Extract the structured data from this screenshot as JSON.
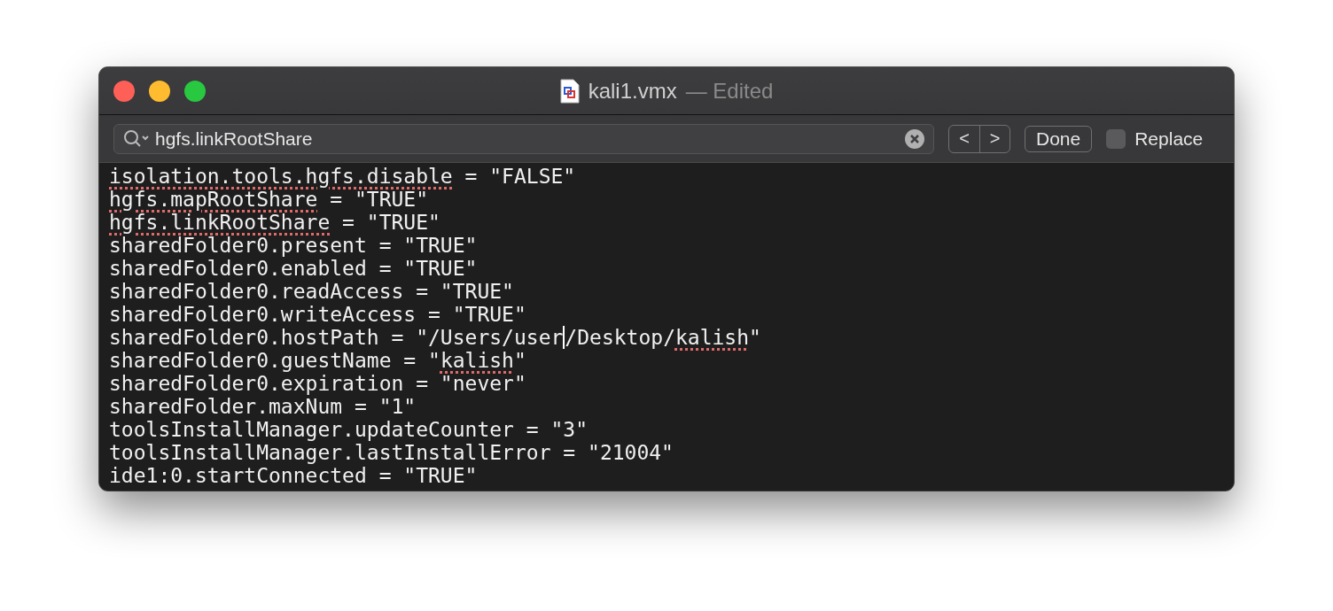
{
  "window": {
    "title": "kali1.vmx",
    "subtitle": "— Edited"
  },
  "find_bar": {
    "query": "hgfs.linkRootShare",
    "previous": "<",
    "next": ">",
    "done": "Done",
    "replace": {
      "label": "Replace",
      "checked": false
    }
  },
  "editor": {
    "lines": [
      [
        {
          "text": "isolation.tools.hgfs.disable",
          "misspelled": true
        },
        {
          "text": " = \"FALSE\"",
          "misspelled": false
        }
      ],
      [
        {
          "text": "hgfs.mapRootShare",
          "misspelled": true
        },
        {
          "text": " = \"TRUE\"",
          "misspelled": false
        }
      ],
      [
        {
          "text": "hgfs.linkRootShare",
          "misspelled": true
        },
        {
          "text": " = \"TRUE\"",
          "misspelled": false
        }
      ],
      [
        {
          "text": "sharedFolder0.present = \"TRUE\"",
          "misspelled": false
        }
      ],
      [
        {
          "text": "sharedFolder0.enabled = \"TRUE\"",
          "misspelled": false
        }
      ],
      [
        {
          "text": "sharedFolder0.readAccess = \"TRUE\"",
          "misspelled": false
        }
      ],
      [
        {
          "text": "sharedFolder0.writeAccess = \"TRUE\"",
          "misspelled": false
        }
      ],
      [
        {
          "text": "sharedFolder0.hostPath = \"/Users/user",
          "misspelled": false,
          "caret": true
        },
        {
          "text": "/Desktop/",
          "misspelled": false
        },
        {
          "text": "kalish",
          "misspelled": true
        },
        {
          "text": "\"",
          "misspelled": false
        }
      ],
      [
        {
          "text": "sharedFolder0.guestName = \"",
          "misspelled": false
        },
        {
          "text": "kalish",
          "misspelled": true
        },
        {
          "text": "\"",
          "misspelled": false
        }
      ],
      [
        {
          "text": "sharedFolder0.expiration = \"never\"",
          "misspelled": false
        }
      ],
      [
        {
          "text": "sharedFolder.maxNum = \"1\"",
          "misspelled": false
        }
      ],
      [
        {
          "text": "toolsInstallManager.updateCounter = \"3\"",
          "misspelled": false
        }
      ],
      [
        {
          "text": "toolsInstallManager.lastInstallError = \"21004\"",
          "misspelled": false
        }
      ],
      [
        {
          "text": "ide1:0.startConnected = \"TRUE\"",
          "misspelled": false
        }
      ]
    ]
  }
}
